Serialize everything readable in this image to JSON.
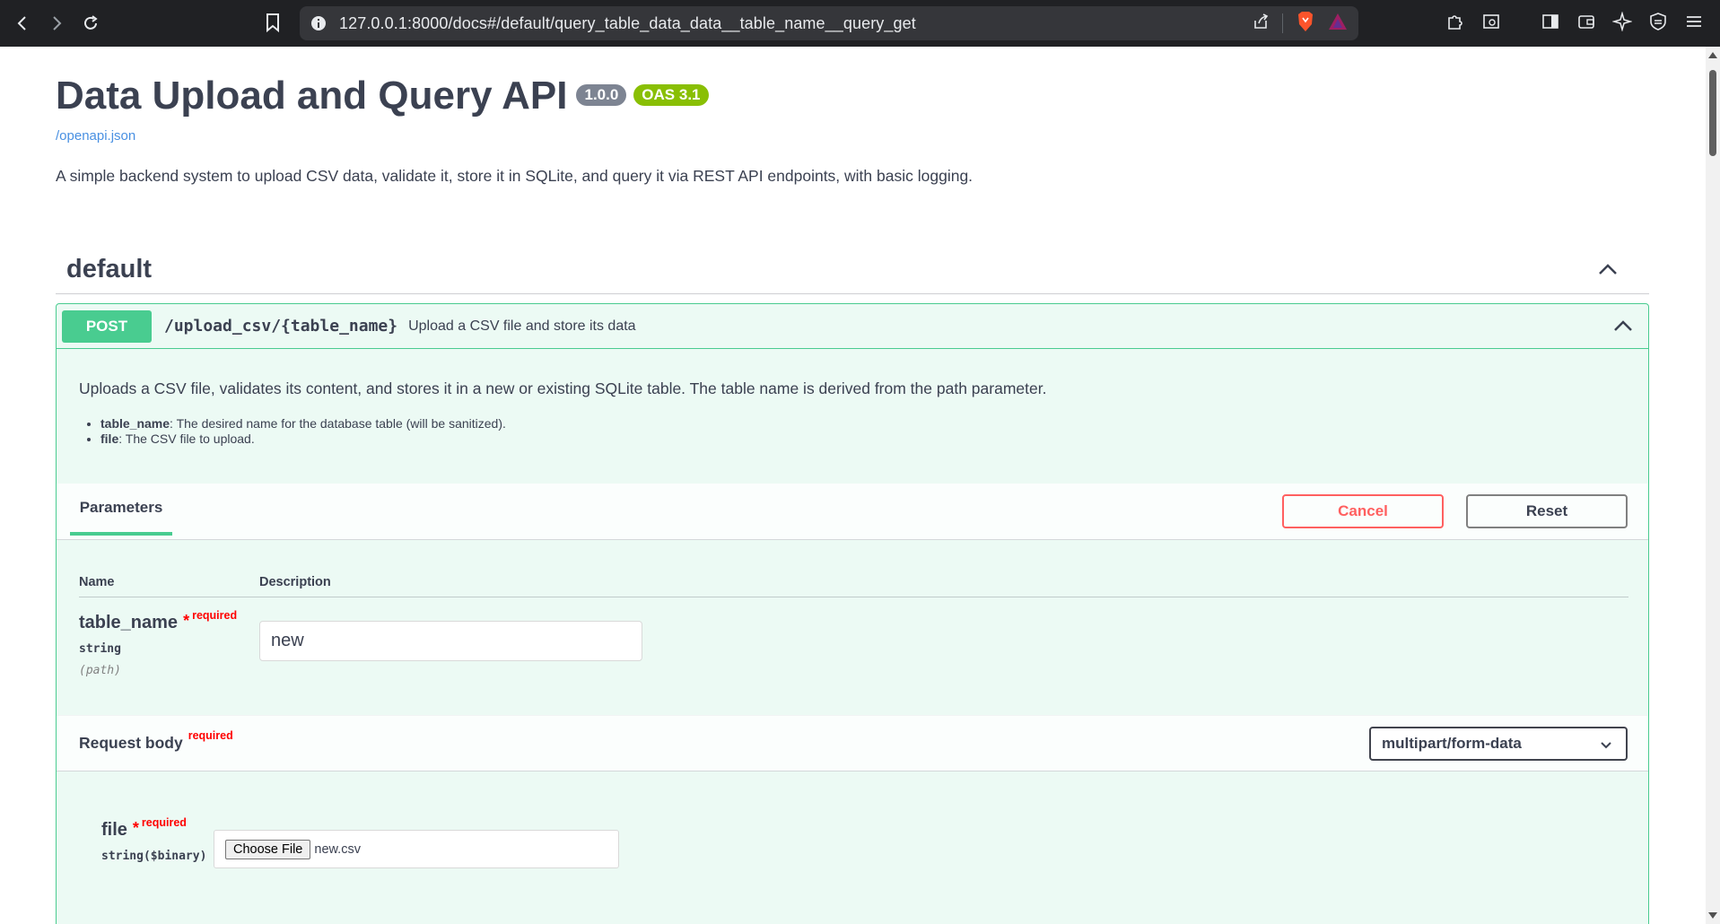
{
  "browser": {
    "url": "127.0.0.1:8000/docs#/default/query_table_data_data__table_name__query_get"
  },
  "header": {
    "title": "Data Upload and Query API",
    "version_badge": "1.0.0",
    "oas_badge": "OAS 3.1",
    "spec_link": "/openapi.json",
    "description": "A simple backend system to upload CSV data, validate it, store it in SQLite, and query it via REST API endpoints, with basic logging."
  },
  "tag": {
    "name": "default"
  },
  "operation": {
    "method": "POST",
    "path": "/upload_csv/{table_name}",
    "summary": "Upload a CSV file and store its data",
    "description": "Uploads a CSV file, validates its content, and stores it in a new or existing SQLite table. The table name is derived from the path parameter.",
    "bullets": [
      {
        "term": "table_name",
        "text": ": The desired name for the database table (will be sanitized)."
      },
      {
        "term": "file",
        "text": ": The CSV file to upload."
      }
    ]
  },
  "parameters": {
    "tab_label": "Parameters",
    "cancel_label": "Cancel",
    "reset_label": "Reset",
    "col_name": "Name",
    "col_description": "Description",
    "items": [
      {
        "name": "table_name",
        "star": "*",
        "required": "required",
        "type": "string",
        "in": "(path)",
        "value": "new"
      }
    ]
  },
  "request_body": {
    "title": "Request body",
    "required": "required",
    "content_type": "multipart/form-data",
    "field": {
      "name": "file",
      "star": "*",
      "required": "required",
      "type": "string($binary)",
      "button": "Choose File",
      "filename": "new.csv"
    }
  }
}
